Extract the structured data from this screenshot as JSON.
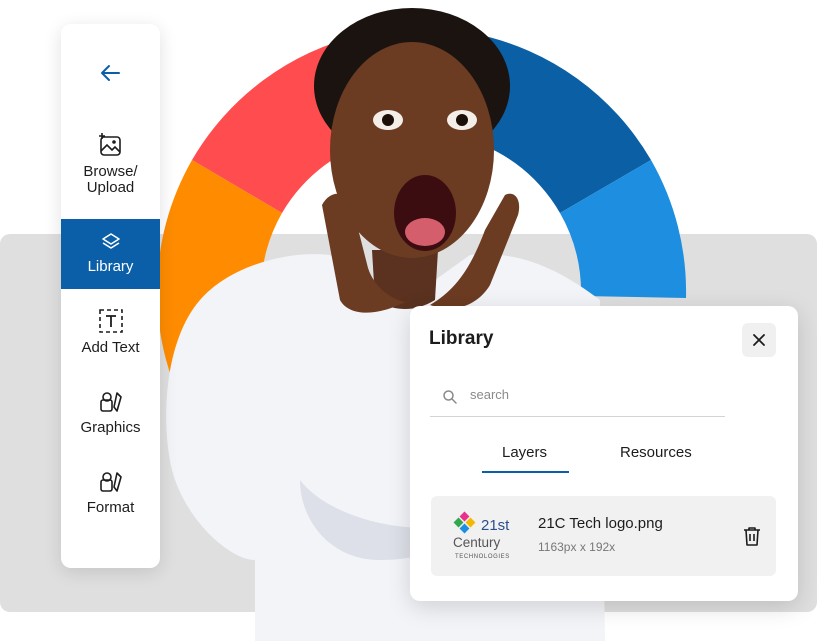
{
  "sidebar": {
    "back_icon": "arrow-left-icon",
    "items": [
      {
        "label_line1": "Browse/",
        "label_line2": "Upload",
        "icon": "image-add-icon",
        "active": false
      },
      {
        "label": "Library",
        "icon": "layers-icon",
        "active": true
      },
      {
        "label": "Add Text",
        "icon": "text-box-icon",
        "active": false
      },
      {
        "label": "Graphics",
        "icon": "shapes-icon",
        "active": false
      },
      {
        "label": "Format",
        "icon": "format-shapes-icon",
        "active": false
      }
    ]
  },
  "library": {
    "title": "Library",
    "search_placeholder": "search",
    "tabs": [
      {
        "label": "Layers",
        "active": true
      },
      {
        "label": "Resources",
        "active": false
      }
    ],
    "files": [
      {
        "name": "21C Tech logo.png",
        "dimensions": "1163px x 192x",
        "thumb_line1": "21st",
        "thumb_line2": "Century",
        "thumb_line3": "TECHNOLOGIES"
      }
    ]
  },
  "colors": {
    "accent": "#0a5fa8",
    "ring_red": "#ff4d4f",
    "ring_orange": "#ff8c00",
    "ring_yellow": "#ffd000",
    "ring_darkblue": "#0b5fa5",
    "ring_blue": "#1e8fe0"
  }
}
